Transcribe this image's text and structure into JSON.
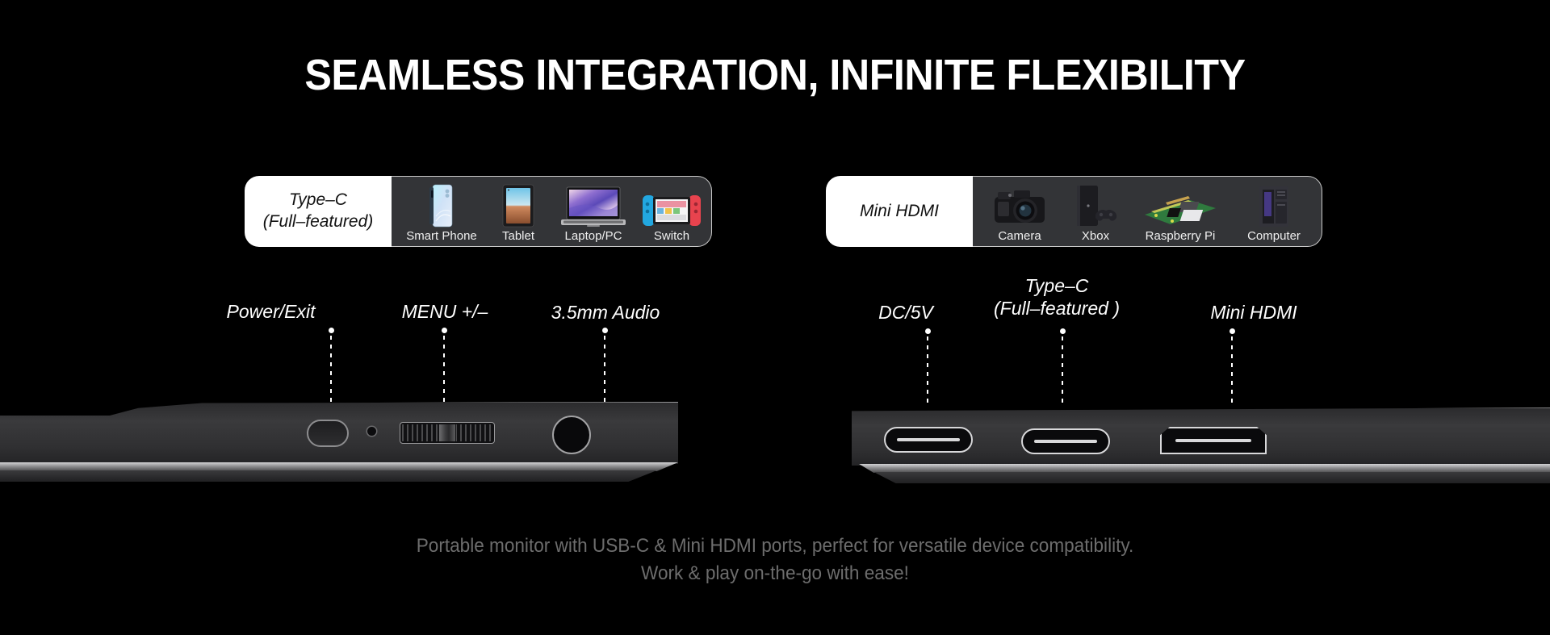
{
  "headline": "SEAMLESS INTEGRATION, INFINITE FLEXIBILITY",
  "colors": {
    "background": "#000000",
    "headline": "#ffffff",
    "badge_label_bg": "#ffffff",
    "badge_label_text": "#111111",
    "badge_strip_bg": "#333437",
    "badge_strip_border": "#c9c9c9",
    "callout_text": "#ffffff",
    "caption_text": "#6d6d6d",
    "port_outline": "#d8d8da"
  },
  "badges": [
    {
      "id": "type-c-badge",
      "label_lines": [
        "Type–C",
        "(Full–featured)"
      ],
      "devices": [
        {
          "name": "Smart Phone",
          "icon": "smartphone-icon"
        },
        {
          "name": "Tablet",
          "icon": "tablet-icon"
        },
        {
          "name": "Laptop/PC",
          "icon": "laptop-icon"
        },
        {
          "name": "Switch",
          "icon": "switch-console-icon"
        }
      ]
    },
    {
      "id": "mini-hdmi-badge",
      "label_lines": [
        "Mini HDMI"
      ],
      "devices": [
        {
          "name": "Camera",
          "icon": "dslr-camera-icon"
        },
        {
          "name": "Xbox",
          "icon": "xbox-console-icon"
        },
        {
          "name": "Raspberry Pi",
          "icon": "raspberry-pi-icon"
        },
        {
          "name": "Computer",
          "icon": "desktop-tower-icon"
        }
      ]
    }
  ],
  "left_panel": {
    "callouts": [
      {
        "id": "power-exit",
        "lines": [
          "Power/Exit"
        ]
      },
      {
        "id": "menu-plus-minus",
        "lines": [
          "MENU +/–"
        ]
      },
      {
        "id": "audio-jack",
        "lines": [
          "3.5mm Audio"
        ]
      }
    ]
  },
  "right_panel": {
    "callouts": [
      {
        "id": "dc-5v",
        "lines": [
          "DC/5V"
        ]
      },
      {
        "id": "type-c-port",
        "lines": [
          "Type–C",
          "(Full–featured )"
        ]
      },
      {
        "id": "mini-hdmi-port",
        "lines": [
          "Mini HDMI"
        ]
      }
    ]
  },
  "caption": {
    "line1": "Portable monitor with USB-C & Mini HDMI ports, perfect for versatile device compatibility.",
    "line2": "Work & play on-the-go with ease!"
  }
}
